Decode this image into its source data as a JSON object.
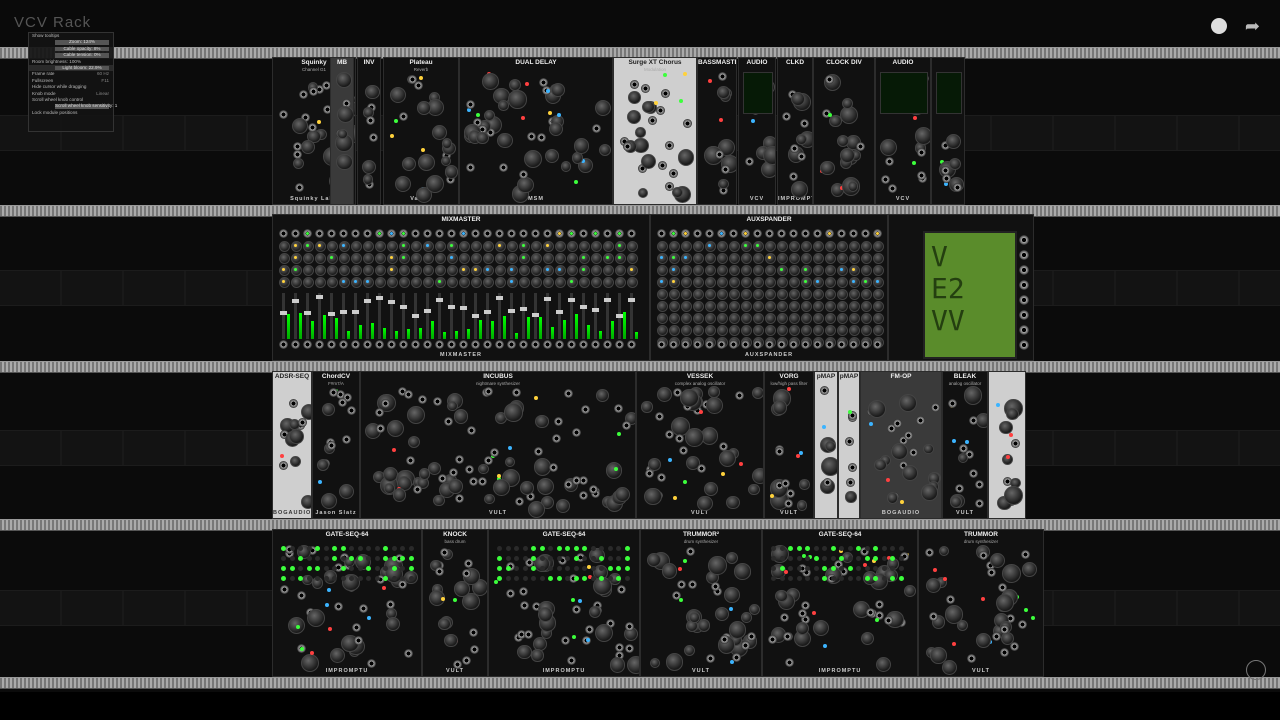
{
  "window": {
    "title": "VCV Rack"
  },
  "menu": {
    "items": [
      {
        "label": "Show tooltips",
        "value": ""
      },
      {
        "label": "Zoom: 124%",
        "value": "slider"
      },
      {
        "label": "Cable opacity: 8%",
        "value": "slider"
      },
      {
        "label": "Cable tension: 0%",
        "value": "slider"
      },
      {
        "label": "Room brightness: 100%",
        "value": ""
      },
      {
        "label": "Light bloom: 22.9%",
        "value": "slider"
      },
      {
        "label": "Frame rate",
        "value": "60 Hz"
      },
      {
        "label": "Fullscreen",
        "value": "F11"
      },
      {
        "label": "Hide cursor while dragging",
        "value": ""
      },
      {
        "label": "Knob mode",
        "value": "Linear"
      },
      {
        "label": "Scroll wheel knob control",
        "value": ""
      },
      {
        "label": "Scroll wheel knob sensitivity: 1",
        "value": "slider"
      },
      {
        "label": "Lock module positions",
        "value": ""
      }
    ]
  },
  "rows": {
    "row1": [
      {
        "name": "Sonus",
        "title": "Squinky",
        "sub": "Channel G1",
        "brand": "Squinky Labs"
      },
      {
        "name": "MB",
        "title": "MB",
        "sub": "",
        "brand": ""
      },
      {
        "name": "INV",
        "title": "INV",
        "sub": "",
        "brand": ""
      },
      {
        "name": "Plateau",
        "title": "Plateau",
        "sub": "Reverb",
        "brand": "Valley"
      },
      {
        "name": "Dual Delay",
        "title": "DUAL DELAY",
        "sub": "",
        "brand": "MSM"
      },
      {
        "name": "Chorus",
        "title": "Surge XT Chorus",
        "sub": "Modulation",
        "brand": ""
      },
      {
        "name": "Bass",
        "title": "BASSMASTER",
        "sub": "",
        "brand": ""
      },
      {
        "name": "Audio",
        "title": "AUDIO",
        "sub": "",
        "brand": "VCV"
      },
      {
        "name": "CLKD",
        "title": "CLKD",
        "sub": "",
        "brand": "IMPROMPTU"
      },
      {
        "name": "ClockDiv",
        "title": "CLOCK DIV",
        "sub": "",
        "brand": ""
      },
      {
        "name": "Audio2",
        "title": "AUDIO",
        "sub": "",
        "brand": "VCV"
      }
    ],
    "row2": [
      {
        "name": "Mixmaster",
        "title": "MIXMASTER",
        "sub": "",
        "brand": "MIXMASTER"
      },
      {
        "name": "Auxspander",
        "title": "AUXSPANDER",
        "sub": "",
        "brand": "AUXSPANDER"
      },
      {
        "name": "Scope",
        "title": "",
        "sub": "",
        "brand": ""
      }
    ],
    "row3": [
      {
        "name": "ADSR-SEQ",
        "title": "ADSR-SEQ",
        "sub": "",
        "brand": "BOGAUDIO"
      },
      {
        "name": "ChordCV",
        "title": "ChordCV",
        "sub": "F#m7/A",
        "brand": "Jason Slatz"
      },
      {
        "name": "Incubus",
        "title": "INCUBUS",
        "sub": "nightmare synthesizer",
        "brand": "VULT"
      },
      {
        "name": "Vessek",
        "title": "VESSEK",
        "sub": "complex analog oscillator",
        "brand": "VULT"
      },
      {
        "name": "Vorg",
        "title": "VORG",
        "sub": "low/high pass filter",
        "brand": "VULT"
      },
      {
        "name": "pMap1",
        "title": "pMAP",
        "sub": "",
        "brand": ""
      },
      {
        "name": "pMap2",
        "title": "pMAP",
        "sub": "",
        "brand": ""
      },
      {
        "name": "FM-OP",
        "title": "FM-OP",
        "sub": "",
        "brand": "BOGAUDIO"
      },
      {
        "name": "Bleak",
        "title": "BLEAK",
        "sub": "analog oscillator",
        "brand": "VULT"
      },
      {
        "name": "Util",
        "title": "",
        "sub": "",
        "brand": ""
      }
    ],
    "row4": [
      {
        "name": "GateSeq1",
        "title": "GATE-SEQ-64",
        "sub": "",
        "brand": "IMPROMPTU"
      },
      {
        "name": "Knock",
        "title": "KNOCK",
        "sub": "bass drum",
        "brand": "VULT"
      },
      {
        "name": "GateSeq2",
        "title": "GATE-SEQ-64",
        "sub": "",
        "brand": "IMPROMPTU"
      },
      {
        "name": "Trummor1",
        "title": "TRUMMOR²",
        "sub": "drum synthesizer",
        "brand": "VULT"
      },
      {
        "name": "GateSeq3",
        "title": "GATE-SEQ-64",
        "sub": "",
        "brand": "IMPROMPTU"
      },
      {
        "name": "Trummor2",
        "title": "TRUMMOR",
        "sub": "drum synthesizer",
        "brand": "VULT"
      }
    ]
  },
  "scope": {
    "text": "V\nE2\nVV"
  },
  "colors": {
    "led_green": "#3cff3c",
    "led_yellow": "#ffd23c",
    "led_blue": "#3cb4ff",
    "led_red": "#ff4040"
  }
}
